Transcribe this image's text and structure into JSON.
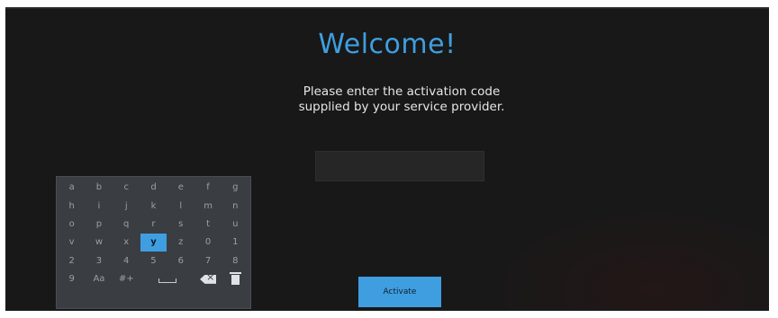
{
  "welcome": {
    "title": "Welcome!",
    "subtitle_line1": "Please enter the activation code",
    "subtitle_line2": "supplied by your service provider."
  },
  "activation_code": {
    "value": "",
    "placeholder": ""
  },
  "keyboard": {
    "rows": [
      [
        "a",
        "b",
        "c",
        "d",
        "e",
        "f",
        "g"
      ],
      [
        "h",
        "i",
        "j",
        "k",
        "l",
        "m",
        "n"
      ],
      [
        "o",
        "p",
        "q",
        "r",
        "s",
        "t",
        "u"
      ],
      [
        "v",
        "w",
        "x",
        "y",
        "z",
        "0",
        "1"
      ],
      [
        "2",
        "3",
        "4",
        "5",
        "6",
        "7",
        "8"
      ]
    ],
    "bottom_row": {
      "nine": "9",
      "case": "Aa",
      "symbols": "#+"
    },
    "selected_key": "y",
    "icons": {
      "space": "space-icon",
      "backspace": "backspace-icon",
      "clear": "trash-icon"
    }
  },
  "actions": {
    "activate_label": "Activate"
  },
  "colors": {
    "accent": "#3f9ee0",
    "background": "#181818",
    "keyboard_bg": "#3a3d41"
  }
}
